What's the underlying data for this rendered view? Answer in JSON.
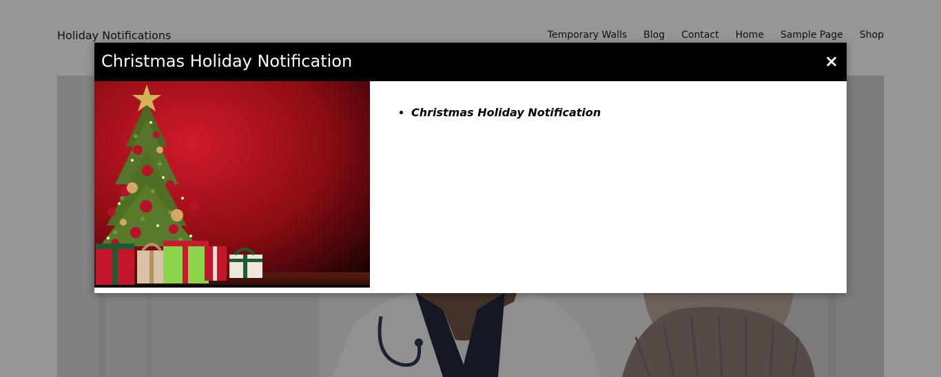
{
  "site": {
    "title": "Holiday Notifications",
    "nav": [
      "Temporary Walls",
      "Blog",
      "Contact",
      "Home",
      "Sample Page",
      "Shop"
    ]
  },
  "modal": {
    "title": "Christmas Holiday Notification",
    "close_label": "×",
    "items": [
      "Christmas Holiday Notification"
    ],
    "image_icon": "christmas-tree-gifts-image"
  },
  "colors": {
    "modal_header_bg": "#000000",
    "modal_title_text": "#ffffff",
    "overlay": "rgba(0,0,0,0.41)",
    "image_background": "#b3121f"
  }
}
